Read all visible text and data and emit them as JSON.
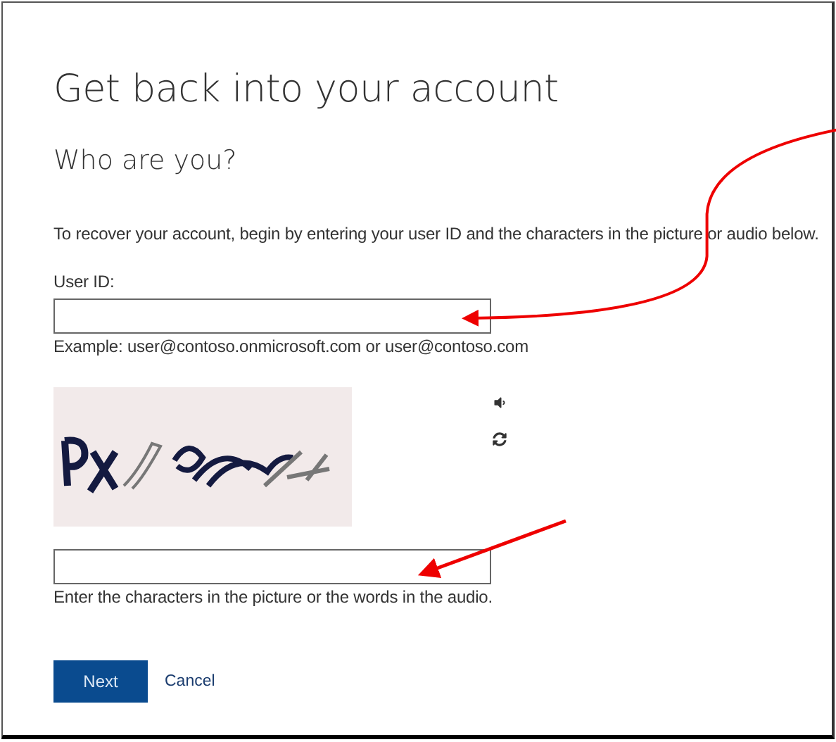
{
  "title": "Get back into your account",
  "subtitle": "Who are you?",
  "instructions": "To recover your account, begin by entering your user ID and the characters in the picture or audio below.",
  "user_id": {
    "label": "User ID:",
    "example": "Example: user@contoso.onmicrosoft.com or user@contoso.com"
  },
  "captcha": {
    "hint": "Enter the characters in the picture or the words in the audio."
  },
  "buttons": [
    {
      "label": "Next",
      "kind": "primary"
    },
    {
      "label": "Cancel",
      "kind": "link"
    }
  ]
}
